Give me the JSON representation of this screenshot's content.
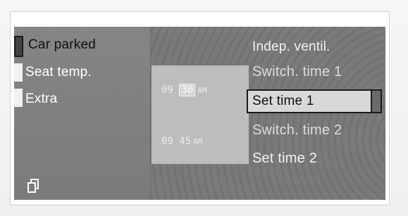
{
  "left_menu": [
    {
      "label": "Car parked",
      "state": "selected"
    },
    {
      "label": "Seat temp."
    },
    {
      "label": "Extra"
    }
  ],
  "right_menu": {
    "title": "Indep. ventil.",
    "items": [
      {
        "label": "Switch. time 1"
      },
      {
        "label": "Set time 1",
        "state": "selected"
      },
      {
        "label": "Switch. time 2"
      },
      {
        "label": "Set time 2"
      }
    ]
  },
  "times": [
    {
      "hour": "09",
      "minute": "30",
      "ampm": "AM"
    },
    {
      "hour": "09",
      "minute": "45",
      "ampm": "AM"
    }
  ],
  "colors": {
    "screen_bg": "#7a7a7a",
    "text": "#ffffff",
    "selected_text": "#111111",
    "time_box": "#bdbdbd"
  },
  "icons": {
    "bottom_left": "copy-icon"
  }
}
